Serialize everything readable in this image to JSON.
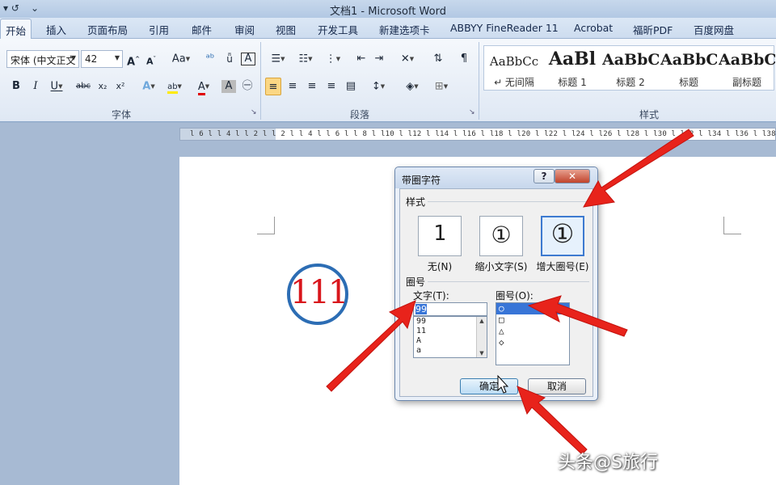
{
  "titlebar": {
    "title": "文档1 - Microsoft Word"
  },
  "tabs": [
    "开始",
    "插入",
    "页面布局",
    "引用",
    "邮件",
    "审阅",
    "视图",
    "开发工具",
    "新建选项卡",
    "ABBYY FineReader 11",
    "Acrobat",
    "福昕PDF",
    "百度网盘"
  ],
  "ribbon": {
    "font_name": "宋体 (中文正文",
    "font_size": "42",
    "groups": {
      "font": "字体",
      "paragraph": "段落",
      "styles": "样式"
    },
    "style_gallery": [
      {
        "sample": "AaBbCc",
        "name": "↵ 无间隔"
      },
      {
        "sample": "AaBl",
        "name": "标题 1"
      },
      {
        "sample": "AaBbC",
        "name": "标题 2"
      },
      {
        "sample": "AaBbC",
        "name": "标题"
      },
      {
        "sample": "AaBbC",
        "name": "副标题"
      }
    ]
  },
  "ruler": {
    "ticks": "l 6 l  l 4 l  l 2 l     l 2 l  l 4 l  l 6 l  l 8 l  l10 l  l12 l  l14 l  l16 l  l18 l  l20 l  l22 l  l24 l  l26 l  l28 l  l30 l  l32 l  l34 l  l36 l  l38"
  },
  "document": {
    "circled_text": "111"
  },
  "dialog": {
    "title": "带圈字符",
    "help": "?",
    "close": "✕",
    "style_section": "样式",
    "style_options": [
      {
        "glyph": "1",
        "label": "无(N)"
      },
      {
        "glyph": "①",
        "label": "缩小文字(S)"
      },
      {
        "glyph": "①",
        "label": "增大圈号(E)"
      }
    ],
    "enclosure_section": "圈号",
    "text_label": "文字(T):",
    "text_value": "99",
    "text_list": [
      "99",
      "11",
      "A",
      "a"
    ],
    "enclosure_label": "圈号(O):",
    "enclosure_list": [
      "○",
      "□",
      "△",
      "◇"
    ],
    "ok": "确定",
    "cancel": "取消"
  },
  "watermark": "头条@S旅行",
  "colors": {
    "arrow": "#e8231b",
    "circle": "#2c6db4",
    "circled_text": "#d9161c"
  }
}
